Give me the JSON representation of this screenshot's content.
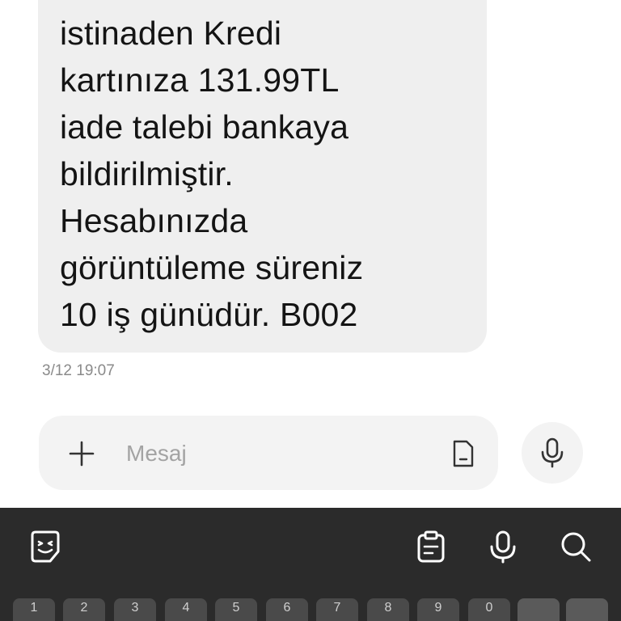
{
  "message": {
    "lines": [
      "istinaden Kredi",
      "kartınıza 131.99TL",
      "iade talebi bankaya",
      "bildirilmiştir.",
      "Hesabınızda",
      "görüntüleme süreniz",
      "10 iş günüdür. B002"
    ],
    "timestamp": "3/12 19:07"
  },
  "composer": {
    "placeholder": "Mesaj"
  },
  "keyboard": {
    "number_row": [
      "1",
      "2",
      "3",
      "4",
      "5",
      "6",
      "7",
      "8",
      "9",
      "0"
    ],
    "tools": [
      "emoji-sticker-icon",
      "clipboard-icon",
      "voice-input-icon",
      "search-icon"
    ]
  },
  "colors": {
    "bubble": "#efefef",
    "keyboard_bg": "#2b2b2b",
    "key_bg": "#4a4a4a"
  }
}
